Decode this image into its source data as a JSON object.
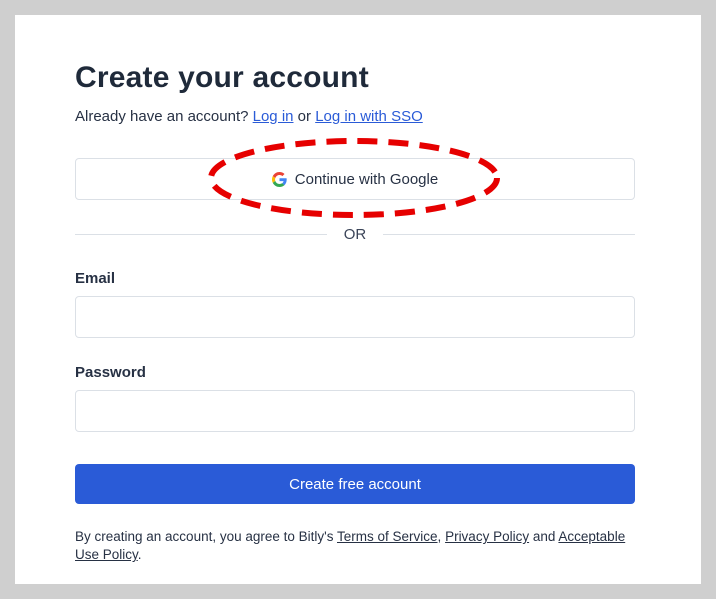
{
  "page": {
    "title": "Create your account"
  },
  "signin": {
    "prompt": "Already have an account?",
    "login_link": "Log in",
    "or_text": "or",
    "sso_link": "Log in with SSO"
  },
  "google_button": {
    "label": "Continue with Google",
    "icon": "google-g-icon",
    "highlight_color": "#e60000"
  },
  "divider": {
    "text": "OR"
  },
  "form": {
    "email_label": "Email",
    "email_value": "",
    "password_label": "Password",
    "password_value": "",
    "submit_label": "Create free account"
  },
  "terms": {
    "prefix": "By creating an account, you agree to Bitly's",
    "tos_link": "Terms of Service",
    "comma": ",",
    "privacy_link": "Privacy Policy",
    "and_text": "and",
    "aup_link": "Acceptable Use Policy",
    "period": "."
  },
  "colors": {
    "accent": "#2a5bd7",
    "background": "#cfcfcf",
    "text": "#273144"
  }
}
